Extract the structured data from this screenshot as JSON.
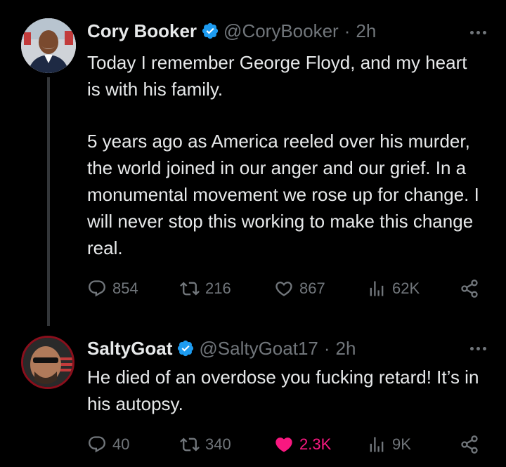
{
  "tweets": [
    {
      "name": "Cory Booker",
      "handle": "@CoryBooker",
      "separator": "·",
      "time": "2h",
      "verified_color": "#1d9bf0",
      "text_paragraphs": [
        "Today I remember George Floyd, and my heart is with his family.",
        "5 years ago as America reeled over his murder, the world joined in our anger and our grief. In a monumental movement we rose up for change. I will never stop this working to make this change real."
      ],
      "stats": {
        "replies": "854",
        "reposts": "216",
        "likes": "867",
        "views": "62K"
      },
      "liked": false
    },
    {
      "name": "SaltyGoat",
      "handle": "@SaltyGoat17",
      "separator": "·",
      "time": "2h",
      "verified_color": "#1d9bf0",
      "text_paragraphs": [
        "He died of an overdose you fucking retard! It’s in his autopsy."
      ],
      "stats": {
        "replies": "40",
        "reposts": "340",
        "likes": "2.3K",
        "views": "9K"
      },
      "liked": true,
      "liked_color": "#f91880"
    }
  ],
  "icons": {
    "reply": "reply-icon",
    "repost": "repost-icon",
    "like": "heart-icon",
    "views": "views-icon",
    "share": "share-icon",
    "more": "more-icon",
    "verified": "verified-badge-icon"
  }
}
